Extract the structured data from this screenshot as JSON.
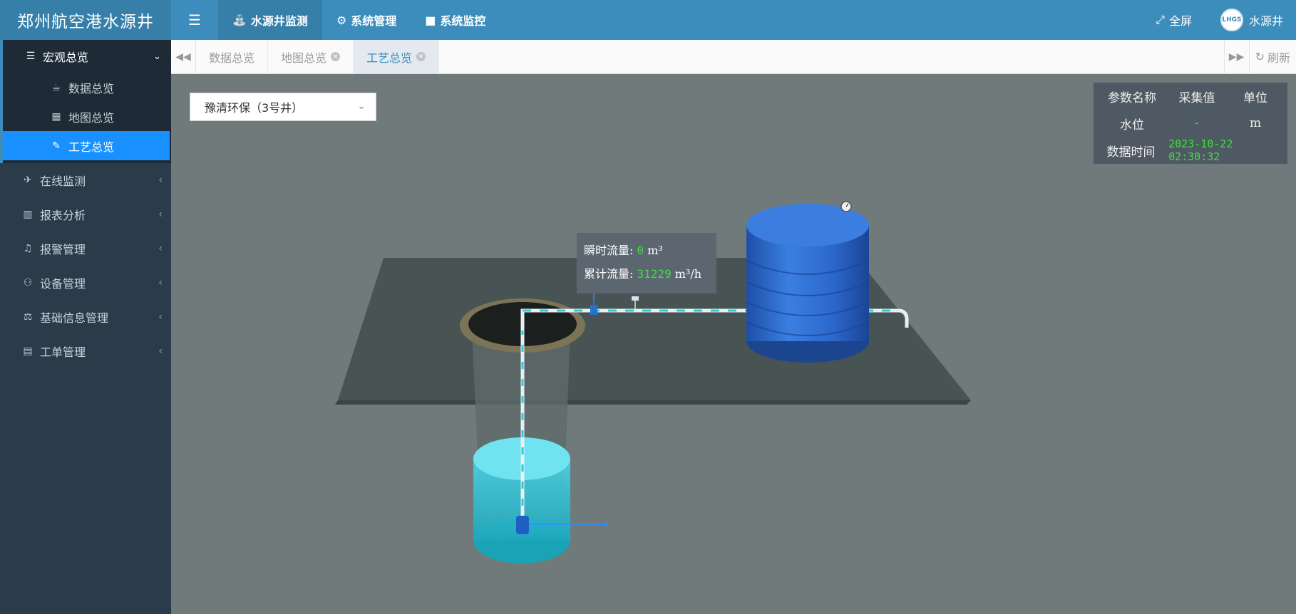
{
  "header": {
    "logo": "郑州航空港水源井",
    "nav": [
      {
        "label": "水源井监测",
        "active": true
      },
      {
        "label": "系统管理",
        "active": false
      },
      {
        "label": "系统监控",
        "active": false
      }
    ],
    "fullscreen": "全屏",
    "user": "水源井",
    "avatar_text": "LHGS"
  },
  "sidebar": {
    "group": {
      "label": "宏观总览",
      "items": [
        {
          "label": "数据总览",
          "icon": "coffee-icon"
        },
        {
          "label": "地图总览",
          "icon": "map-icon"
        },
        {
          "label": "工艺总览",
          "icon": "eyedropper-icon",
          "active": true
        }
      ]
    },
    "items": [
      {
        "label": "在线监测",
        "icon": "monitor-icon"
      },
      {
        "label": "报表分析",
        "icon": "bar-chart-icon"
      },
      {
        "label": "报警管理",
        "icon": "bell-icon"
      },
      {
        "label": "设备管理",
        "icon": "motorcycle-icon"
      },
      {
        "label": "基础信息管理",
        "icon": "balance-icon"
      },
      {
        "label": "工单管理",
        "icon": "word-file-icon"
      }
    ]
  },
  "tabs": [
    {
      "label": "数据总览",
      "closable": false,
      "active": false
    },
    {
      "label": "地图总览",
      "closable": true,
      "active": false
    },
    {
      "label": "工艺总览",
      "closable": true,
      "active": true
    }
  ],
  "refresh": "刷新",
  "well_select": {
    "value": "豫清环保（3号井）"
  },
  "params": {
    "headers": [
      "参数名称",
      "采集值",
      "单位"
    ],
    "water_level": {
      "name": "水位",
      "value": "-",
      "unit": "m"
    },
    "time_label": "数据时间",
    "time_value": "2023-10-22 02:30:32"
  },
  "flow": {
    "instant_label": "瞬时流量:",
    "instant_value": "0",
    "instant_unit": "m³",
    "total_label": "累计流量:",
    "total_value": "31229",
    "total_unit": "m³/h"
  },
  "colors": {
    "header": "#3c8dbc",
    "sidebar": "#2c3b4a",
    "active_menu": "#1890ff",
    "value_green": "#3fdf3f",
    "tank_blue": "#2f6fd0",
    "water_cyan": "#3cc8d8"
  }
}
